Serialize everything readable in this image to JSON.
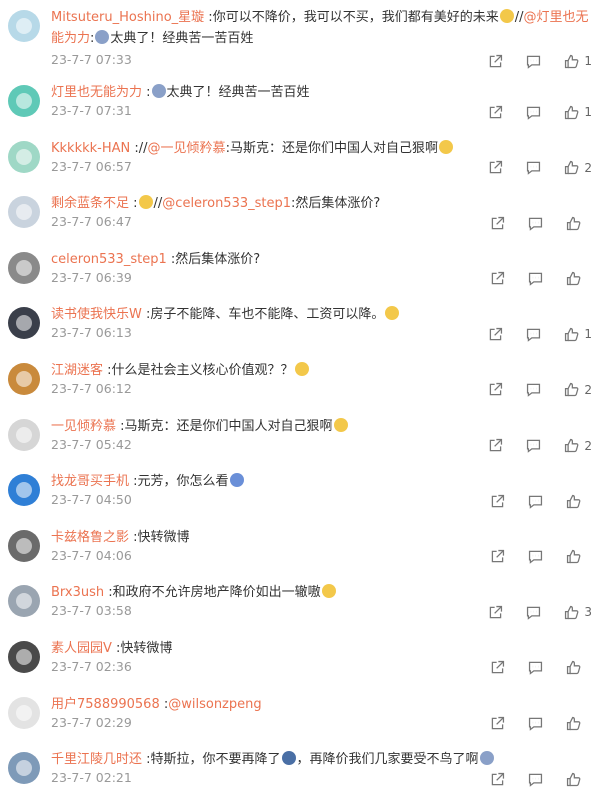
{
  "colors": {
    "username": "#eb7350",
    "text": "#333333",
    "time": "#999999",
    "icon": "#777777"
  },
  "icons": {
    "share": "share-icon",
    "comment": "comment-icon",
    "like": "thumbs-up-icon"
  },
  "comments": [
    {
      "user": "Mitsuteru_Hoshino_星璇",
      "sep": " :",
      "segments": [
        {
          "t": "你可以不降价，我可以不买，我们都有美好的未来"
        },
        {
          "e": "#f3c84a"
        },
        {
          "t": "//"
        },
        {
          "m": "@灯里也无能为力"
        },
        {
          "t": ":"
        },
        {
          "e": "#8aa0c8"
        },
        {
          "t": "太典了！经典苦一苦百姓"
        }
      ],
      "time": "23-7-7 07:33",
      "likes": "1",
      "avatar": "#b7d9e8"
    },
    {
      "user": "灯里也无能为力",
      "sep": " :",
      "segments": [
        {
          "e": "#8aa0c8"
        },
        {
          "t": "太典了！经典苦一苦百姓"
        }
      ],
      "time": "23-7-7 07:31",
      "likes": "1",
      "avatar": "#5fc9b7"
    },
    {
      "user": "Kkkkkk-HAN",
      "sep": " ://",
      "segments": [
        {
          "m": "@一见倾矜慕"
        },
        {
          "t": ":马斯克：还是你们中国人对自己狠啊"
        },
        {
          "e": "#f3c84a"
        }
      ],
      "time": "23-7-7 06:57",
      "likes": "2",
      "avatar": "#9fd8c6"
    },
    {
      "user": "剩余蓝条不足",
      "sep": " :",
      "segments": [
        {
          "e": "#f3c84a"
        },
        {
          "t": "//"
        },
        {
          "m": "@celeron533_step1"
        },
        {
          "t": ":然后集体涨价?"
        }
      ],
      "time": "23-7-7 06:47",
      "likes": "",
      "avatar": "#c9d3de"
    },
    {
      "user": "celeron533_step1",
      "sep": " :",
      "segments": [
        {
          "t": "然后集体涨价?"
        }
      ],
      "time": "23-7-7 06:39",
      "likes": "",
      "avatar": "#8a8a8a"
    },
    {
      "user": "读书使我快乐W",
      "sep": " :",
      "segments": [
        {
          "t": "房子不能降、车也不能降、工资可以降。"
        },
        {
          "e": "#f3c84a"
        }
      ],
      "time": "23-7-7 06:13",
      "likes": "1",
      "avatar": "#3a3f4a"
    },
    {
      "user": "江湖迷客",
      "sep": " :",
      "segments": [
        {
          "t": "什么是社会主义核心价值观？？"
        },
        {
          "e": "#f3c84a"
        }
      ],
      "time": "23-7-7 06:12",
      "likes": "2",
      "avatar": "#c98a3c"
    },
    {
      "user": "一见倾矜慕",
      "sep": " :",
      "segments": [
        {
          "t": "马斯克：还是你们中国人对自己狠啊"
        },
        {
          "e": "#f3c84a"
        }
      ],
      "time": "23-7-7 05:42",
      "likes": "2",
      "avatar": "#d6d6d6"
    },
    {
      "user": "找龙哥买手机",
      "sep": " :",
      "segments": [
        {
          "t": "元芳，你怎么看"
        },
        {
          "e": "#6a8fd8"
        }
      ],
      "time": "23-7-7 04:50",
      "likes": "",
      "avatar": "#2f7fd6"
    },
    {
      "user": "卡兹格鲁之影",
      "sep": " :",
      "segments": [
        {
          "t": "快转微博"
        }
      ],
      "time": "23-7-7 04:06",
      "likes": "",
      "avatar": "#6b6b6b"
    },
    {
      "user": "Brx3ush",
      "sep": " :",
      "segments": [
        {
          "t": "和政府不允许房地产降价如出一辙嗷"
        },
        {
          "e": "#f3c84a"
        }
      ],
      "time": "23-7-7 03:58",
      "likes": "3",
      "avatar": "#9aa5b1"
    },
    {
      "user": "素人园园V",
      "sep": " :",
      "segments": [
        {
          "t": "快转微博"
        }
      ],
      "time": "23-7-7 02:36",
      "likes": "",
      "avatar": "#4a4a4a"
    },
    {
      "user": "用户7588990568",
      "sep": " :",
      "segments": [
        {
          "m": "@wilsonzpeng"
        }
      ],
      "time": "23-7-7 02:29",
      "likes": "",
      "avatar": "#e3e3e3"
    },
    {
      "user": "千里江陵几时还",
      "sep": " :",
      "segments": [
        {
          "t": "特斯拉，你不要再降了"
        },
        {
          "e": "#4a6fa5"
        },
        {
          "t": "，再降价我们几家要受不鸟了啊"
        },
        {
          "e": "#8aa0c8"
        }
      ],
      "time": "23-7-7 02:21",
      "likes": "",
      "avatar": "#7e9ab8"
    }
  ]
}
